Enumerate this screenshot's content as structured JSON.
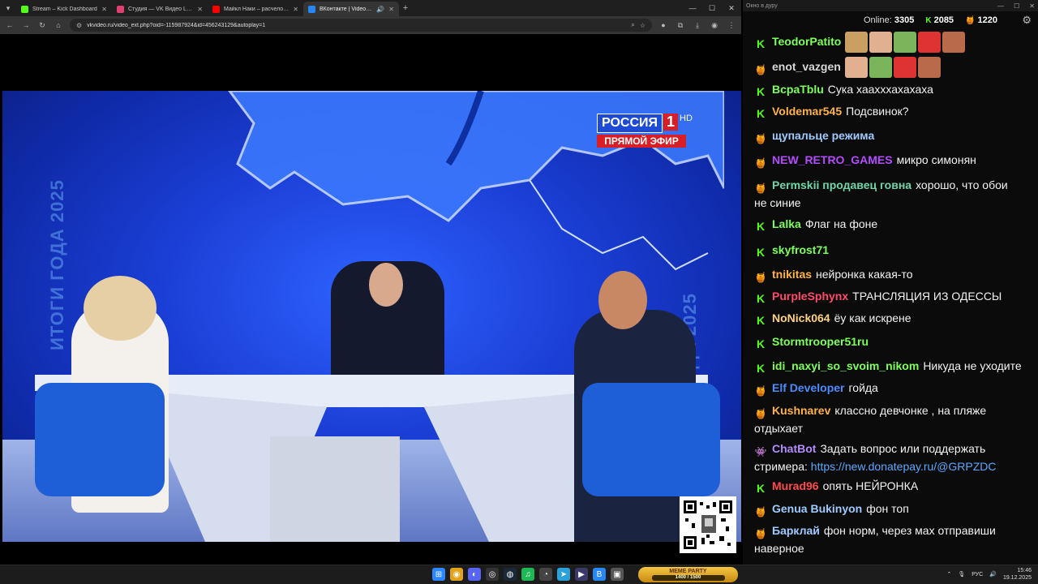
{
  "browser": {
    "tabs": [
      {
        "label": "Stream – Kick Dashboard",
        "color": "#53fc18",
        "active": false
      },
      {
        "label": "Студия — VK Видео Live",
        "color": "#e03f6f",
        "active": false
      },
      {
        "label": "Майкл Наки – расчеловечивание",
        "color": "#ff0000",
        "active": false
      },
      {
        "label": "ВКонтакте | Video Ext",
        "color": "#2787f5",
        "active": true
      }
    ],
    "url": "vkvideo.ru/video_ext.php?oid=-115987924&id=456243129&autoplay=1"
  },
  "video": {
    "channel_name": "РОССИЯ",
    "channel_number": "1",
    "channel_hd": "HD",
    "live_label": "ПРЯМОЙ ЭФИР",
    "side_text_left": "ИТОГИ ГОДА 2025",
    "side_text_right": "ИТОГИ ГОДА 2025"
  },
  "chat": {
    "window_title": "Окно в дуру",
    "online_label": "Online:",
    "online_count": "3305",
    "kick_viewers": "2085",
    "vk_viewers": "1220",
    "messages": [
      {
        "badge": "kick",
        "nick": "TeodorPatito",
        "color": "#7dff5a",
        "text": "",
        "emotes": 5
      },
      {
        "badge": "vk",
        "nick": "enot_vazgen",
        "color": "#d8d8d8",
        "text": "",
        "emotes": 4
      },
      {
        "badge": "kick",
        "nick": "BcpaTblu",
        "color": "#7dff5a",
        "text": "Сука хаахххахахаха"
      },
      {
        "badge": "kick",
        "nick": "Voldemar545",
        "color": "#ffb347",
        "text": "Подсвинок?"
      },
      {
        "badge": "vk",
        "nick": "щупальце режима",
        "color": "#9ecbff",
        "text": ""
      },
      {
        "badge": "vk",
        "nick": "NEW_RETRO_GAMES",
        "color": "#b44bff",
        "text": "микро симонян"
      },
      {
        "badge": "vk",
        "nick": "Permskii продавец говна",
        "color": "#6fd6a8",
        "text": "хорошо, что обои",
        "text2": "не синие"
      },
      {
        "badge": "kick",
        "nick": "Lalka",
        "color": "#7dff5a",
        "text": "Флаг на фоне"
      },
      {
        "badge": "kick",
        "nick": "skyfrost71",
        "color": "#7dff5a",
        "text": ""
      },
      {
        "badge": "vk",
        "nick": "tnikitas",
        "color": "#ffb347",
        "text": "нейронка какая-то"
      },
      {
        "badge": "kick",
        "nick": "PurpleSphynx",
        "color": "#ff4a6b",
        "text": "ТРАНСЛЯЦИЯ ИЗ ОДЕССЫ"
      },
      {
        "badge": "kick",
        "nick": "NoNick064",
        "color": "#ffd27f",
        "text": "ёу как искрене"
      },
      {
        "badge": "kick",
        "nick": "Stormtrooper51ru",
        "color": "#7dff5a",
        "text": ""
      },
      {
        "badge": "kick",
        "nick": "idi_naxyi_so_svoim_nikom",
        "color": "#7dff5a",
        "text": "Никуда не уходите"
      },
      {
        "badge": "vk",
        "nick": "Elf Developer",
        "color": "#4a8cff",
        "text": "гойда"
      },
      {
        "badge": "vk",
        "nick": "Kushnarev",
        "color": "#ffb347",
        "text": "классно девчонке , на пляже",
        "text2": "отдыхает"
      },
      {
        "badge": "bot",
        "nick": "ChatBot",
        "color": "#b58cff",
        "text": "Задать вопрос или поддержать",
        "text2": "стримера:",
        "link": "https://new.donatepay.ru/@GRPZDC"
      },
      {
        "badge": "kick",
        "nick": "Murad96",
        "color": "#ff4a4a",
        "text": "опять НЕЙРОНКА"
      },
      {
        "badge": "vk",
        "nick": "Genua Bukinyon",
        "color": "#9ecbff",
        "text": "фон топ"
      },
      {
        "badge": "vk",
        "nick": "Барклай",
        "color": "#9ecbff",
        "text": "фон норм, через мах отправиши",
        "text2": "наверное"
      }
    ]
  },
  "taskbar": {
    "meme_party_title": "MEME PARTY",
    "meme_party_progress": "1400 / 1500",
    "lang": "РУС",
    "time": "15:46",
    "date": "19.12.2025"
  }
}
